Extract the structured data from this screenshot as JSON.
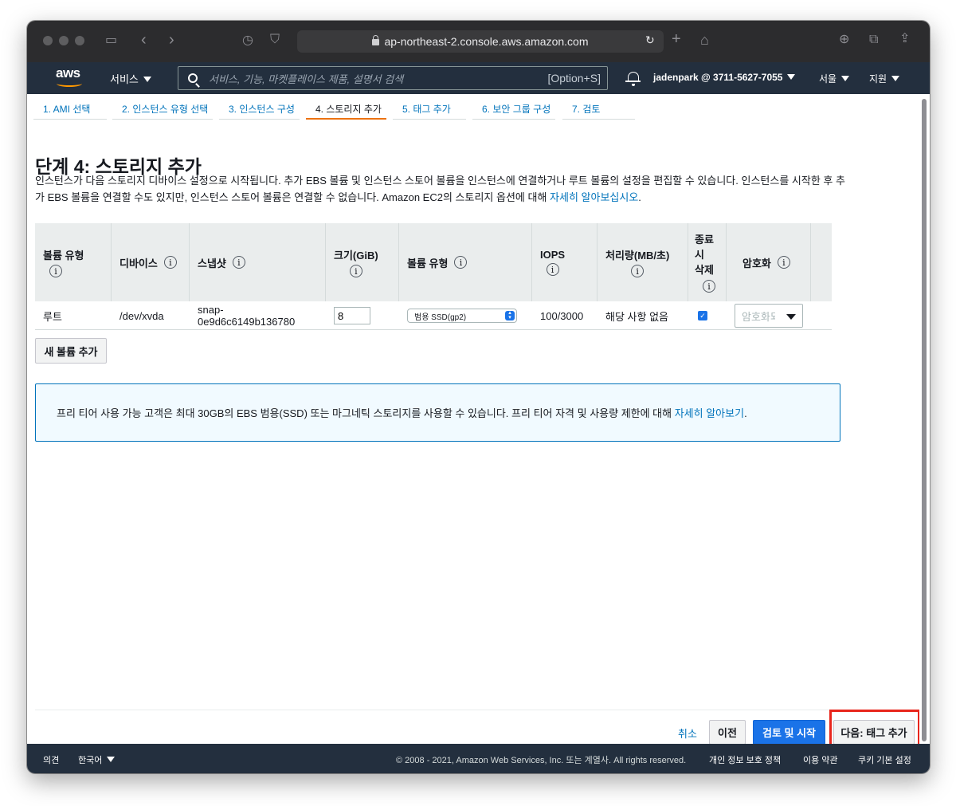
{
  "browser": {
    "url": "ap-northeast-2.console.aws.amazon.com"
  },
  "aws_nav": {
    "logo_text": "aws",
    "services_label": "서비스",
    "search_placeholder": "서비스, 기능, 마켓플레이스 제품, 설명서 검색",
    "search_shortcut": "[Option+S]",
    "account_label": "jadenpark @ 3711-5627-7055",
    "region_label": "서울",
    "support_label": "지원"
  },
  "steps": [
    {
      "label": "1. AMI 선택",
      "active": false
    },
    {
      "label": "2. 인스턴스 유형 선택",
      "active": false
    },
    {
      "label": "3. 인스턴스 구성",
      "active": false
    },
    {
      "label": "4. 스토리지 추가",
      "active": true
    },
    {
      "label": "5. 태그 추가",
      "active": false
    },
    {
      "label": "6. 보안 그룹 구성",
      "active": false
    },
    {
      "label": "7. 검토",
      "active": false
    }
  ],
  "page": {
    "title": "단계 4: 스토리지 추가",
    "description": "인스턴스가 다음 스토리지 디바이스 설정으로 시작됩니다. 추가 EBS 볼륨 및 인스턴스 스토어 볼륨을 인스턴스에 연결하거나 루트 볼륨의 설정을 편집할 수 있습니다. 인스턴스를 시작한 후 추가 EBS 볼륨을 연결할 수도 있지만, 인스턴스 스토어 볼륨은 연결할 수 없습니다. Amazon EC2의 스토리지 옵션에 대해 ",
    "description_link": "자세히 알아보십시오",
    "description_end": "."
  },
  "table": {
    "headers": {
      "volume_type": "볼륨 유형",
      "device": "디바이스",
      "snapshot": "스냅샷",
      "size": "크기(GiB)",
      "ebs_volume_type": "볼륨 유형",
      "iops": "IOPS",
      "throughput": "처리량(MB/초)",
      "delete_line1": "종료",
      "delete_line2": "시",
      "delete_line3": "삭제",
      "encryption": "암호화"
    },
    "info_glyph": "i",
    "rows": [
      {
        "volume_type": "루트",
        "device": "/dev/xvda",
        "snapshot_line1": "snap-",
        "snapshot_line2": "0e9d6c6149b136780",
        "size": "8",
        "ebs_volume_type": "범용 SSD(gp2)",
        "iops": "100/3000",
        "throughput": "해당 사항 없음",
        "delete_on_termination": true,
        "encryption": "암호화되지 않음"
      }
    ]
  },
  "add_volume_label": "새 볼륨 추가",
  "alert": {
    "text": "프리 티어 사용 가능 고객은 최대 30GB의 EBS 범용(SSD) 또는 마그네틱 스토리지를 사용할 수 있습니다. 프리 티어 자격 및 사용량 제한에 대해 ",
    "link": "자세히 알아보기",
    "end": "."
  },
  "actions": {
    "cancel": "취소",
    "previous": "이전",
    "review_launch": "검토 및 시작",
    "next": "다음: 태그 추가"
  },
  "footer": {
    "feedback": "의견",
    "language": "한국어",
    "copyright": "© 2008 - 2021, Amazon Web Services, Inc. 또는 계열사. All rights reserved.",
    "privacy": "개인 정보 보호 정책",
    "terms": "이용 약관",
    "cookies": "쿠키 기본 설정"
  },
  "colors": {
    "aws_nav_bg": "#232f3e",
    "accent_orange": "#ec7211",
    "link_blue": "#0073bb",
    "primary_button": "#1a73e8",
    "highlight_red": "#e8251b"
  }
}
